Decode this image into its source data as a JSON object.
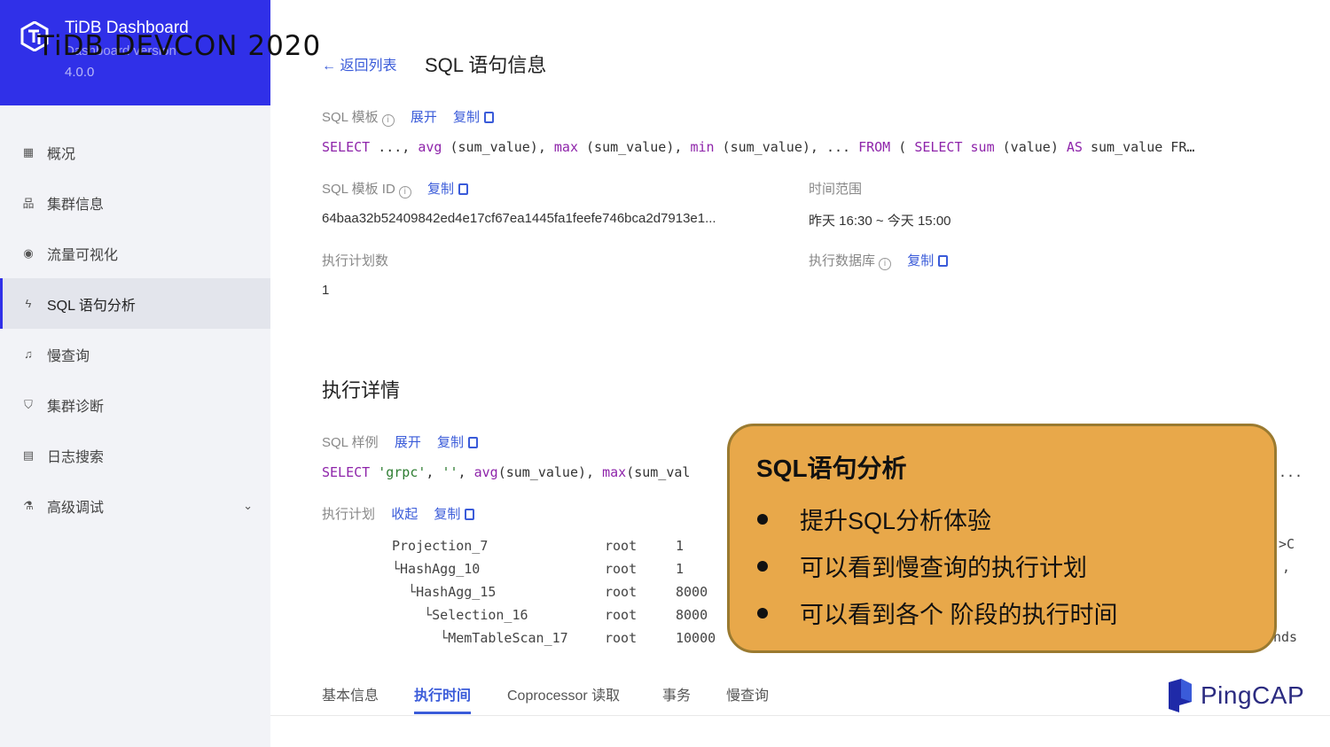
{
  "brand": {
    "name": "TiDB Dashboard",
    "sub": "Dashboard version",
    "version": "4.0.0",
    "overlay_title": "TiDB DEVCON 2020",
    "color": "#3030e8"
  },
  "sidebar": {
    "items": [
      {
        "label": "概况",
        "icon": "grid-icon",
        "glyph": "▦"
      },
      {
        "label": "集群信息",
        "icon": "cluster-icon",
        "glyph": "品"
      },
      {
        "label": "流量可视化",
        "icon": "eye-icon",
        "glyph": "◉"
      },
      {
        "label": "SQL 语句分析",
        "icon": "bolt-icon",
        "glyph": "ϟ"
      },
      {
        "label": "慢查询",
        "icon": "bell-icon",
        "glyph": "♫"
      },
      {
        "label": "集群诊断",
        "icon": "shield-icon",
        "glyph": "⛉"
      },
      {
        "label": "日志搜索",
        "icon": "file-icon",
        "glyph": "▤"
      },
      {
        "label": "高级调试",
        "icon": "flask-icon",
        "glyph": "⚗"
      }
    ],
    "active_index": 3
  },
  "header": {
    "back_label": "返回列表",
    "title": "SQL 语句信息"
  },
  "detail": {
    "template_label": "SQL 模板",
    "expand_label": "展开",
    "copy_label": "复制",
    "template_id_label": "SQL 模板 ID",
    "template_id_value": "64baa32b52409842ed4e17cf67ea1445fa1feefe746bca2d7913e1...",
    "time_range_label": "时间范围",
    "time_range_value": "昨天 16:30 ~ 今天 15:00",
    "plan_count_label": "执行计划数",
    "plan_count_value": "1",
    "exec_db_label": "执行数据库"
  },
  "exec": {
    "section_title": "执行详情",
    "sample_label": "SQL 样例",
    "expand_label": "展开",
    "copy_label": "复制",
    "plan_label": "执行计划",
    "collapse_label": "收起",
    "plan_rows": [
      {
        "op": "Projection_7",
        "task": "root",
        "rows": "1"
      },
      {
        "op": "└HashAgg_10",
        "task": "root",
        "rows": "1"
      },
      {
        "op": "  └HashAgg_15",
        "task": "root",
        "rows": "8000"
      },
      {
        "op": "    └Selection_16",
        "task": "root",
        "rows": "8000"
      },
      {
        "op": "      └MemTableScan_17",
        "task": "root",
        "rows": "10000"
      }
    ],
    "edge_fragments": [
      ">C",
      ",",
      "nds"
    ],
    "sample_tail": "..."
  },
  "tabs": [
    {
      "label": "基本信息"
    },
    {
      "label": "执行时间"
    },
    {
      "label": "Coprocessor 读取"
    },
    {
      "label": "事务"
    },
    {
      "label": "慢查询"
    }
  ],
  "callout": {
    "title": "SQL语句分析",
    "bullets": [
      "提升SQL分析体验",
      "可以看到慢查询的执行计划",
      "可以看到各个 阶段的执行时间"
    ],
    "bg": "#e8a84a"
  },
  "footer_logo": "PingCAP",
  "colors": {
    "link": "#3a5bd9",
    "keyword": "#8e24aa",
    "string": "#2e7d32"
  }
}
